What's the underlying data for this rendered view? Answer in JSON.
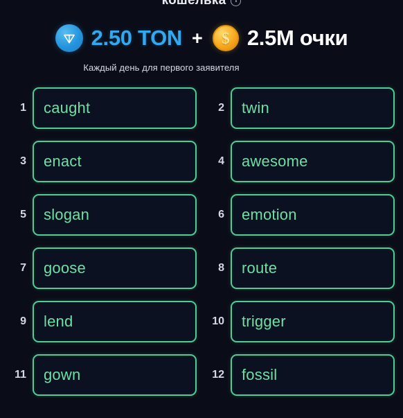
{
  "header": {
    "title": "кошелька",
    "info_icon": "info-icon"
  },
  "reward": {
    "ton_icon": "ton-coin-icon",
    "ton_amount": "2.50 TON",
    "plus": "+",
    "points_icon": "dollar-coin-icon",
    "points_symbol": "$",
    "points_amount": "2.5M очки",
    "subtitle": "Каждый день для первого заявителя"
  },
  "colors": {
    "background": "#0a0d18",
    "box_border": "#52cc93",
    "word_text": "#6ee0a4",
    "ton_blue": "#31a8ef",
    "coin_gold": "#f7a81c",
    "white": "#ffffff",
    "index_gray": "#d4d8e2"
  },
  "seed_phrase": [
    {
      "index": "1",
      "word": "caught"
    },
    {
      "index": "2",
      "word": "twin"
    },
    {
      "index": "3",
      "word": "enact"
    },
    {
      "index": "4",
      "word": "awesome"
    },
    {
      "index": "5",
      "word": "slogan"
    },
    {
      "index": "6",
      "word": "emotion"
    },
    {
      "index": "7",
      "word": "goose"
    },
    {
      "index": "8",
      "word": "route"
    },
    {
      "index": "9",
      "word": "lend"
    },
    {
      "index": "10",
      "word": "trigger"
    },
    {
      "index": "11",
      "word": "gown"
    },
    {
      "index": "12",
      "word": "fossil"
    }
  ]
}
